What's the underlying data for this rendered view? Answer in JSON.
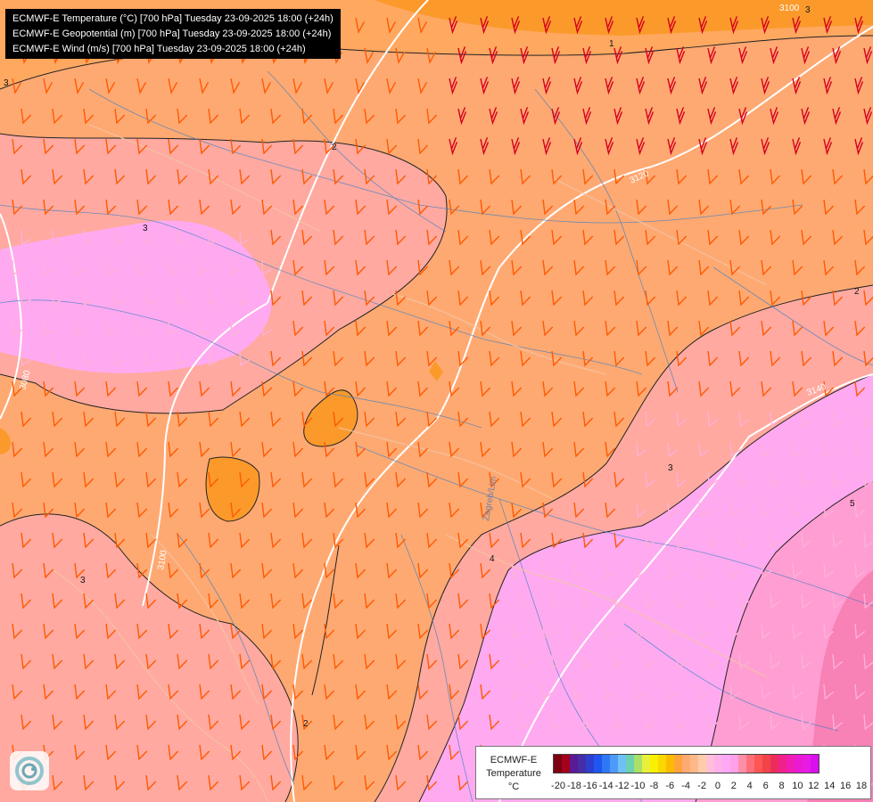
{
  "title_lines": [
    "ECMWF-E Temperature (°C) [700 hPa] Tuesday 23-09-2025 18:00 (+24h)",
    "ECMWF-E Geopotential (m) [700 hPa] Tuesday 23-09-2025 18:00 (+24h)",
    "ECMWF-E Wind (m/s) [700 hPa] Tuesday 23-09-2025 18:00 (+24h)"
  ],
  "isotherm_labels": [
    "1",
    "2",
    "3",
    "2",
    "3",
    "3",
    "4",
    "5",
    "2",
    "3",
    "3"
  ],
  "geopotential_labels": [
    "3100",
    "3120",
    "3140",
    "3080",
    "3100"
  ],
  "place_label": "Zagreb/Lim",
  "legend": {
    "model": "ECMWF-E",
    "variable": "Temperature",
    "unit": "°C",
    "ticks": [
      "-20",
      "-18",
      "-16",
      "-14",
      "-12",
      "-10",
      "-8",
      "-6",
      "-4",
      "-2",
      "0",
      "2",
      "4",
      "6",
      "8",
      "10",
      "12",
      "14",
      "16",
      "18"
    ],
    "colors": [
      "#7f0012",
      "#a5001c",
      "#5b1a96",
      "#452ea8",
      "#2c3fd0",
      "#1f56f0",
      "#2f78f5",
      "#4e9af8",
      "#6fc0f4",
      "#6bd1b0",
      "#a8e06a",
      "#e7f03a",
      "#f8f000",
      "#fbd600",
      "#fcbb00",
      "#ffa33a",
      "#ffa972",
      "#ffb989",
      "#ffccaa",
      "#ffbfd8",
      "#ffb0ea",
      "#ffa9f6",
      "#ffa0e8",
      "#ff8fa8",
      "#ff6f7a",
      "#ff5555",
      "#f24448",
      "#ee2c5c",
      "#f0218a",
      "#f01cb4",
      "#ea1ad2",
      "#e81ae4",
      "#d810f0"
    ]
  },
  "colors": {
    "band_1": "#fb9a2b",
    "band_1_5": "#ffa860",
    "band_2": "#ffa972",
    "band_3": "#ffa9a0",
    "band_4": "#ffaaf0",
    "band_5": "#ff9ed2",
    "band_6": "#f881b6",
    "barb_warm": "#ff5a00",
    "barb_strong": "#d4001e",
    "barb_light": "#ffb0d8",
    "rivers": "#3b7fc4",
    "coast": "#f2c5a4"
  }
}
